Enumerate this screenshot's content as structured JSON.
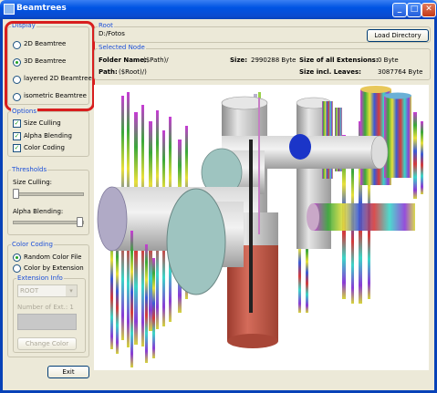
{
  "window": {
    "title": "Beamtrees"
  },
  "display": {
    "legend": "Display",
    "options": [
      {
        "label": "2D Beamtree",
        "selected": false
      },
      {
        "label": "3D Beamtree",
        "selected": true
      },
      {
        "label": "layered 2D Beamtree",
        "selected": false
      },
      {
        "label": "isometric Beamtree",
        "selected": false
      }
    ]
  },
  "options": {
    "legend": "Options",
    "checks": [
      {
        "label": "Size Culling",
        "checked": true
      },
      {
        "label": "Alpha Blending",
        "checked": true
      },
      {
        "label": "Color Coding",
        "checked": true
      }
    ]
  },
  "thresholds": {
    "legend": "Thresholds",
    "size_culling_label": "Size Culling:",
    "size_culling_value": 0.0,
    "alpha_blending_label": "Alpha Blending:",
    "alpha_blending_value": 1.0
  },
  "color_coding": {
    "legend": "Color Coding",
    "options": [
      {
        "label": "Random Color File",
        "selected": true
      },
      {
        "label": "Color by Extension",
        "selected": false
      }
    ],
    "extension_info": {
      "legend": "Extension Info",
      "select_value": "ROOT",
      "number_label": "Number of Ext.: 1",
      "button_label": "Change Color"
    }
  },
  "exit_label": "Exit",
  "root": {
    "legend": "Root",
    "path": "D:/Fotos"
  },
  "load_label": "Load Directory",
  "selected_node": {
    "legend": "Selected Node",
    "folder_name_label": "Folder Name:",
    "folder_name_value": "($Path)/",
    "path_label": "Path:",
    "path_value": "($Root)/)",
    "size_label": "Size:",
    "size_value": "2990288 Byte",
    "ext_label": "Size of all Extensions:",
    "ext_value": "0 Byte",
    "leaves_label": "Size incl. Leaves:",
    "leaves_value": "3087764 Byte"
  },
  "colors": {
    "highlight_box": "#d81e1e",
    "pink": "#b06b80",
    "cyl_grey": "#cfcfcf",
    "cyl_red": "#c35a4a",
    "cyl_teal": "#9ec4c0",
    "blue_cap": "#1b35c8"
  }
}
